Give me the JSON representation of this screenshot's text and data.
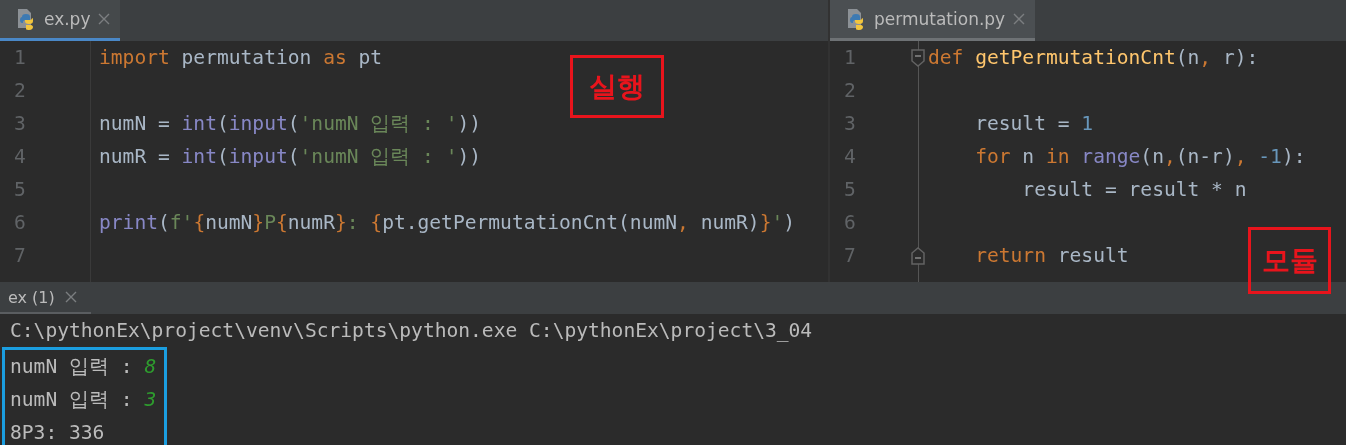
{
  "editors": [
    {
      "tab": {
        "label": "ex.py",
        "selected": true
      },
      "lines": [
        {
          "number": "1",
          "kind": "plain",
          "tokens": [
            {
              "text": "import",
              "kind": "keyword"
            },
            {
              "text": " permutation ",
              "kind": "plain"
            },
            {
              "text": "as",
              "kind": "keyword"
            },
            {
              "text": " pt",
              "kind": "plain"
            }
          ]
        },
        {
          "number": "2",
          "kind": "plain"
        },
        {
          "number": "3",
          "kind": "plain",
          "tokens": [
            {
              "text": "numN = ",
              "kind": "plain"
            },
            {
              "text": "int",
              "kind": "builtin"
            },
            {
              "text": "(",
              "kind": "plain"
            },
            {
              "text": "input",
              "kind": "builtin"
            },
            {
              "text": "(",
              "kind": "plain"
            },
            {
              "text": "'numN 입력 : '",
              "kind": "string"
            },
            {
              "text": "))",
              "kind": "plain"
            }
          ]
        },
        {
          "number": "4",
          "kind": "plain",
          "tokens": [
            {
              "text": "numR = ",
              "kind": "plain"
            },
            {
              "text": "int",
              "kind": "builtin"
            },
            {
              "text": "(",
              "kind": "plain"
            },
            {
              "text": "input",
              "kind": "builtin"
            },
            {
              "text": "(",
              "kind": "plain"
            },
            {
              "text": "'numN 입력 : '",
              "kind": "string"
            },
            {
              "text": "))",
              "kind": "plain"
            }
          ]
        },
        {
          "number": "5",
          "kind": "plain"
        },
        {
          "number": "6",
          "kind": "plain",
          "tokens": [
            {
              "text": "print",
              "kind": "builtin"
            },
            {
              "text": "(",
              "kind": "plain"
            },
            {
              "text": "f'",
              "kind": "string"
            },
            {
              "text": "{",
              "kind": "brace"
            },
            {
              "text": "numN",
              "kind": "plain"
            },
            {
              "text": "}",
              "kind": "brace"
            },
            {
              "text": "P",
              "kind": "string"
            },
            {
              "text": "{",
              "kind": "brace"
            },
            {
              "text": "numR",
              "kind": "plain"
            },
            {
              "text": "}",
              "kind": "brace"
            },
            {
              "text": ": ",
              "kind": "string"
            },
            {
              "text": "{",
              "kind": "brace"
            },
            {
              "text": "pt.getPermutationCnt(numN",
              "kind": "plain"
            },
            {
              "text": ", ",
              "kind": "keyword"
            },
            {
              "text": "numR)",
              "kind": "plain"
            },
            {
              "text": "}",
              "kind": "brace"
            },
            {
              "text": "'",
              "kind": "string"
            },
            {
              "text": ")",
              "kind": "plain"
            }
          ]
        },
        {
          "number": "7",
          "kind": "plain"
        }
      ]
    },
    {
      "tab": {
        "label": "permutation.py",
        "selected": false
      },
      "lines": [
        {
          "number": "1",
          "kind": "fold_start",
          "tokens": [
            {
              "text": "def",
              "kind": "keyword"
            },
            {
              "text": " getPermutationCnt",
              "kind": "function"
            },
            {
              "text": "(n",
              "kind": "plain"
            },
            {
              "text": ",",
              "kind": "keyword"
            },
            {
              "text": " r):",
              "kind": "plain"
            }
          ]
        },
        {
          "number": "2",
          "kind": "plain"
        },
        {
          "number": "3",
          "kind": "plain",
          "tokens": [
            {
              "text": "    result = ",
              "kind": "plain"
            },
            {
              "text": "1",
              "kind": "number"
            }
          ]
        },
        {
          "number": "4",
          "kind": "plain",
          "tokens": [
            {
              "text": "    for",
              "kind": "keyword"
            },
            {
              "text": " n ",
              "kind": "plain"
            },
            {
              "text": "in",
              "kind": "keyword"
            },
            {
              "text": " range",
              "kind": "builtin"
            },
            {
              "text": "(n",
              "kind": "plain"
            },
            {
              "text": ",",
              "kind": "keyword"
            },
            {
              "text": "(n-r)",
              "kind": "plain"
            },
            {
              "text": ",",
              "kind": "keyword"
            },
            {
              "text": " -1",
              "kind": "number"
            },
            {
              "text": "):",
              "kind": "plain"
            }
          ]
        },
        {
          "number": "5",
          "kind": "plain",
          "tokens": [
            {
              "text": "        result = result * n",
              "kind": "plain"
            }
          ]
        },
        {
          "number": "6",
          "kind": "plain"
        },
        {
          "number": "7",
          "kind": "fold_end",
          "tokens": [
            {
              "text": "    return",
              "kind": "keyword"
            },
            {
              "text": " result",
              "kind": "plain"
            }
          ]
        }
      ]
    }
  ],
  "run_panel": {
    "tab": {
      "label": "ex (1)",
      "selected": true
    },
    "lines": [
      {
        "text": "C:\\pythonEx\\project\\venv\\Scripts\\python.exe C:\\pythonEx\\project\\3_04",
        "boxed": false
      },
      {
        "text": "numN 입력 : ",
        "input": "8",
        "boxed": true
      },
      {
        "text": "numN 입력 : ",
        "input": "3",
        "boxed": true
      },
      {
        "text": "8P3: 336",
        "boxed": true
      }
    ]
  },
  "annotations": [
    {
      "text": "실행",
      "color": "#e8141c"
    },
    {
      "text": "모듈",
      "color": "#e8141c"
    }
  ],
  "console_highlight": {
    "color": "#1b9ee0"
  }
}
